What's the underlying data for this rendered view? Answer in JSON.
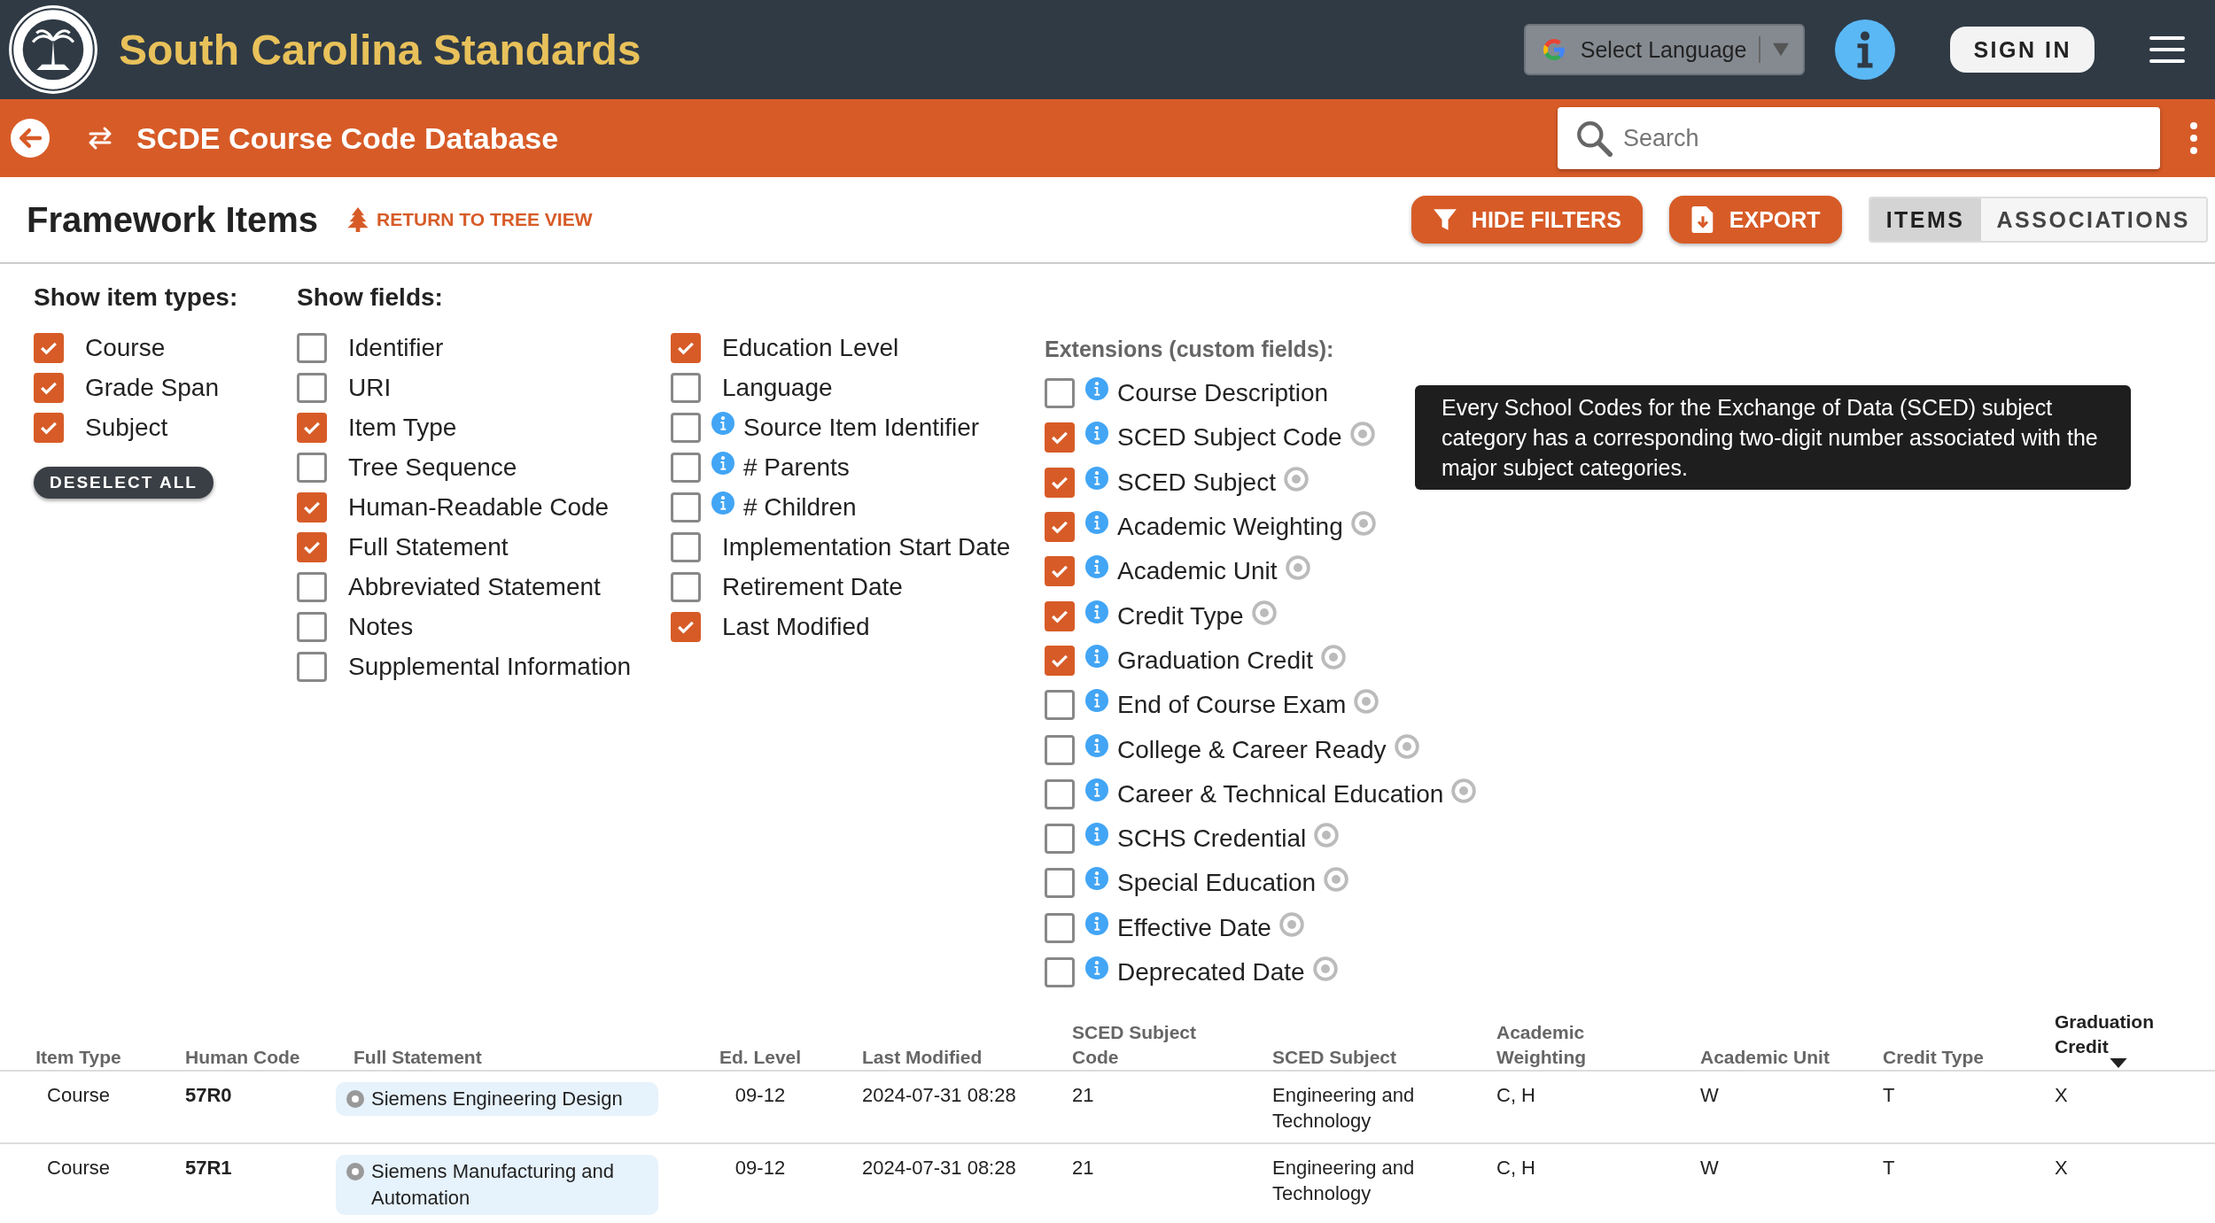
{
  "header": {
    "site_title": "South Carolina Standards",
    "language_select": {
      "label": "Select Language"
    },
    "sign_in": "SIGN IN"
  },
  "subheader": {
    "title": "SCDE Course Code Database",
    "search": {
      "placeholder": "Search"
    }
  },
  "toolbar": {
    "heading": "Framework Items",
    "return_link": "RETURN TO TREE VIEW",
    "hide_filters": "HIDE FILTERS",
    "export": "EXPORT",
    "views": [
      {
        "label": "ITEMS",
        "selected": true
      },
      {
        "label": "ASSOCIATIONS",
        "selected": false
      }
    ]
  },
  "item_types": {
    "label": "Show item types:",
    "items": [
      {
        "label": "Course",
        "checked": true
      },
      {
        "label": "Grade Span",
        "checked": true
      },
      {
        "label": "Subject",
        "checked": true
      }
    ],
    "deselect": "DESELECT ALL"
  },
  "fields": {
    "label": "Show fields:",
    "columns": [
      [
        {
          "label": "Identifier",
          "checked": false,
          "info": false
        },
        {
          "label": "URI",
          "checked": false,
          "info": false
        },
        {
          "label": "Item Type",
          "checked": true,
          "info": false
        },
        {
          "label": "Tree Sequence",
          "checked": false,
          "info": false
        },
        {
          "label": "Human-Readable Code",
          "checked": true,
          "info": false
        },
        {
          "label": "Full Statement",
          "checked": true,
          "info": false
        },
        {
          "label": "Abbreviated Statement",
          "checked": false,
          "info": false
        },
        {
          "label": "Notes",
          "checked": false,
          "info": false
        },
        {
          "label": "Supplemental Information",
          "checked": false,
          "info": false
        }
      ],
      [
        {
          "label": "Education Level",
          "checked": true,
          "info": false
        },
        {
          "label": "Language",
          "checked": false,
          "info": false
        },
        {
          "label": "Source Item Identifier",
          "checked": false,
          "info": true
        },
        {
          "label": "# Parents",
          "checked": false,
          "info": true
        },
        {
          "label": "# Children",
          "checked": false,
          "info": true
        },
        {
          "label": "Implementation Start Date",
          "checked": false,
          "info": false
        },
        {
          "label": "Retirement Date",
          "checked": false,
          "info": false
        },
        {
          "label": "Last Modified",
          "checked": true,
          "info": false
        }
      ]
    ]
  },
  "extensions": {
    "label": "Extensions (custom fields):",
    "items": [
      {
        "label": "Course Description",
        "checked": false,
        "eye": false
      },
      {
        "label": "SCED Subject Code",
        "checked": true,
        "eye": true
      },
      {
        "label": "SCED Subject",
        "checked": true,
        "eye": true
      },
      {
        "label": "Academic Weighting",
        "checked": true,
        "eye": true
      },
      {
        "label": "Academic Unit",
        "checked": true,
        "eye": true
      },
      {
        "label": "Credit Type",
        "checked": true,
        "eye": true
      },
      {
        "label": "Graduation Credit",
        "checked": true,
        "eye": true
      },
      {
        "label": "End of Course Exam",
        "checked": false,
        "eye": true
      },
      {
        "label": "College & Career Ready",
        "checked": false,
        "eye": true
      },
      {
        "label": "Career & Technical Education",
        "checked": false,
        "eye": true
      },
      {
        "label": "SCHS Credential",
        "checked": false,
        "eye": true
      },
      {
        "label": "Special Education",
        "checked": false,
        "eye": true
      },
      {
        "label": "Effective Date",
        "checked": false,
        "eye": true
      },
      {
        "label": "Deprecated Date",
        "checked": false,
        "eye": true
      }
    ]
  },
  "tooltip": {
    "text": "Every School Codes for the Exchange of Data (SCED) subject category has a corresponding two-digit number associated with the major subject categories."
  },
  "table": {
    "columns": [
      {
        "label": "Item Type",
        "kind": "center",
        "sorted": false
      },
      {
        "label": "Human Code",
        "kind": "bold",
        "sorted": false
      },
      {
        "label": "Full Statement",
        "kind": "pill",
        "sorted": false
      },
      {
        "label": "Ed. Level",
        "kind": "center",
        "sorted": false
      },
      {
        "label": "Last Modified",
        "kind": "plain",
        "sorted": false
      },
      {
        "label": "SCED Subject Code",
        "kind": "plain",
        "sorted": false
      },
      {
        "label": "SCED Subject",
        "kind": "plain",
        "sorted": false
      },
      {
        "label": "Academic Weighting",
        "kind": "plain",
        "sorted": false
      },
      {
        "label": "Academic Unit",
        "kind": "plain",
        "sorted": false
      },
      {
        "label": "Credit Type",
        "kind": "plain",
        "sorted": false
      },
      {
        "label": "Graduation Credit",
        "kind": "plain",
        "sorted": true
      }
    ],
    "rows": [
      [
        "Course",
        "57R0",
        "Siemens Engineering Design",
        "09-12",
        "2024-07-31 08:28",
        "21",
        "Engineering and Technology",
        "C, H",
        "W",
        "T",
        "X"
      ],
      [
        "Course",
        "57R1",
        "Siemens Manufacturing and Automation",
        "09-12",
        "2024-07-31 08:28",
        "21",
        "Engineering and Technology",
        "C, H",
        "W",
        "T",
        "X"
      ]
    ]
  }
}
